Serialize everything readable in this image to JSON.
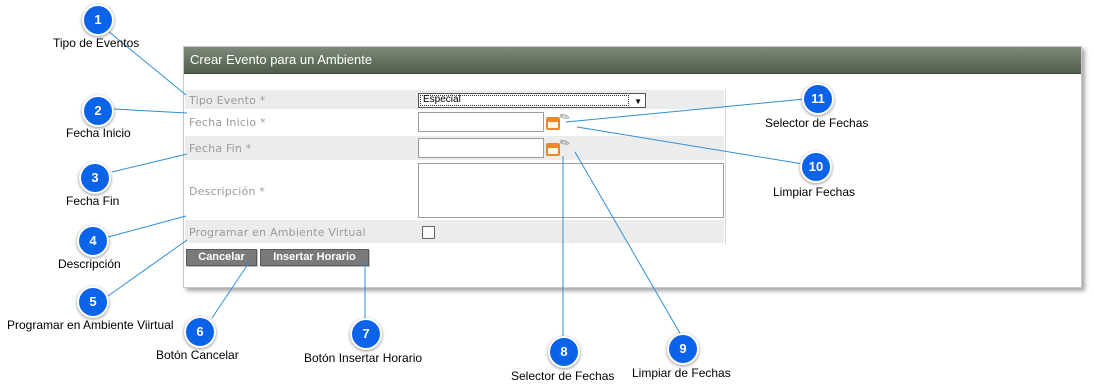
{
  "panel": {
    "title": "Crear Evento para un Ambiente",
    "fields": {
      "tipo_evento": "Tipo Evento *",
      "fecha_inicio": "Fecha Inicio *",
      "fecha_fin": "Fecha Fin *",
      "descripcion": "Descripción *",
      "programar": "Programar en Ambiente Virtual"
    },
    "tipo_evento_value": "Especial",
    "fecha_inicio_value": "",
    "fecha_fin_value": "",
    "descripcion_value": "",
    "programar_checked": false,
    "buttons": {
      "cancel": "Cancelar",
      "insert": "Insertar Horario"
    }
  },
  "callouts": [
    {
      "number": "1",
      "label": "Tipo de Eventos"
    },
    {
      "number": "2",
      "label": "Fecha Inicio"
    },
    {
      "number": "3",
      "label": "Fecha Fin"
    },
    {
      "number": "4",
      "label": "Descripción"
    },
    {
      "number": "5",
      "label": "Programar en Ambiente Viirtual"
    },
    {
      "number": "6",
      "label": "Botón Cancelar"
    },
    {
      "number": "7",
      "label": "Botón Insertar Horario"
    },
    {
      "number": "8",
      "label": "Selector de Fechas"
    },
    {
      "number": "9",
      "label": "Limpiar de Fechas"
    },
    {
      "number": "10",
      "label": "Limpiar Fechas"
    },
    {
      "number": "11",
      "label": "Selector de Fechas"
    }
  ],
  "colors": {
    "badge": "#0b63ea",
    "header": "#5f6d5c",
    "leader": "#2f8fd8"
  },
  "icons": {
    "calendar": "calendar-icon",
    "clear": "eraser-icon",
    "dropdown": "chevron-down-icon"
  }
}
